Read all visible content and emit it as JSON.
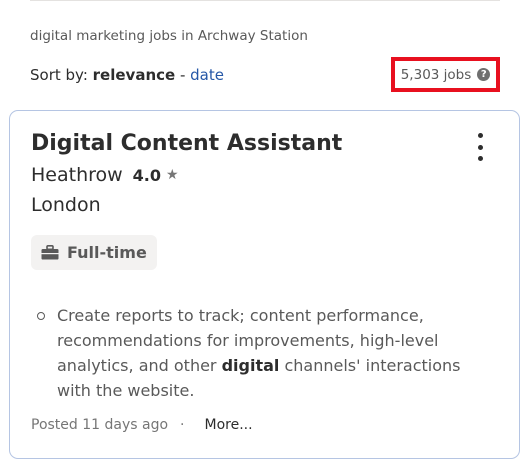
{
  "search": {
    "caption": "digital marketing jobs in Archway Station"
  },
  "sort": {
    "prefix": "Sort by: ",
    "active": "relevance",
    "separator": " - ",
    "alternative": "date"
  },
  "results": {
    "count_label": "5,303 jobs",
    "help_glyph": "?"
  },
  "job": {
    "title": "Digital Content Assistant",
    "company": "Heathrow",
    "rating": "4.0",
    "rating_star": "★",
    "location": "London",
    "badge_label": "Full-time",
    "snippet_before": "Create reports to track; content performance, recommendations for improvements, high-level analytics, and other ",
    "snippet_highlight": "digital",
    "snippet_after": " channels' interactions with the website.",
    "posted": "Posted 11 days ago",
    "separator": "·",
    "more_label": "More..."
  },
  "colors": {
    "highlight_border": "#e8101f",
    "link": "#2557a7",
    "card_border": "#b5c5e3"
  },
  "icons": {
    "badge": "briefcase-icon",
    "menu": "kebab-menu-icon",
    "help": "help-circle-icon",
    "rating": "star-icon"
  }
}
